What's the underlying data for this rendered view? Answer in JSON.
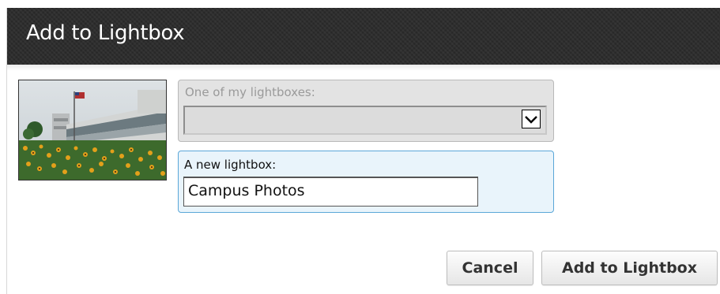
{
  "dialog": {
    "title": "Add to Lightbox"
  },
  "existing": {
    "label": "One of my lightboxes:",
    "selected": "",
    "dropdown_icon": "chevron-down-icon"
  },
  "new_lightbox": {
    "label": "A new lightbox:",
    "value": "Campus Photos"
  },
  "buttons": {
    "cancel": "Cancel",
    "add": "Add to Lightbox"
  },
  "colors": {
    "titlebar": "#2e2e2e",
    "new_group_bg": "#e9f4fb",
    "new_group_border": "#5aa7d8",
    "disabled_group_bg": "#e3e3e3"
  }
}
